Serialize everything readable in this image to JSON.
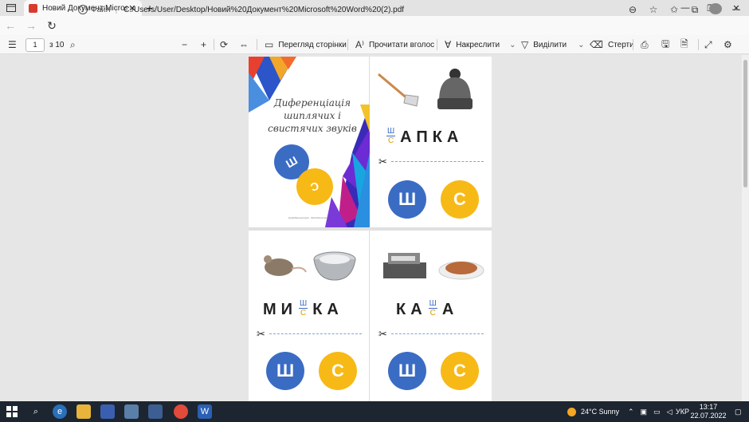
{
  "browser": {
    "tab_title": "Новий Документ Microsoft Wor",
    "tab_close": "✕",
    "new_tab": "+",
    "address_label": "Файл",
    "url": "C:/Users/User/Desktop/Новий%20Документ%20Microsoft%20Word%20(2).pdf"
  },
  "pdf_toolbar": {
    "page_number": "1",
    "page_count": "з 10",
    "page_view_label": "Перегляд сторінки",
    "read_aloud_label": "Прочитати вголос",
    "draw_label": "Накреслити",
    "highlight_label": "Виділити",
    "erase_label": "Стерти"
  },
  "document": {
    "cover": {
      "title": "Диференціація шиплячих і свистячих звуків",
      "circle_top": "Ш",
      "circle_bottom": "С",
      "credit": "розробка вчителя · Word Document"
    },
    "cards": [
      {
        "id": "shapka",
        "prefix": "",
        "suffix": "АПКА",
        "option_top": "Ш",
        "option_bottom": "С",
        "answer_a": "Ш",
        "answer_b": "С",
        "images": [
          "hoe",
          "knit-hat"
        ]
      },
      {
        "id": "myshka",
        "prefix": "МИ",
        "suffix": "КА",
        "option_top": "Ш",
        "option_bottom": "С",
        "answer_a": "Ш",
        "answer_b": "С",
        "images": [
          "mouse",
          "steel-bowl"
        ]
      },
      {
        "id": "kasha",
        "prefix": "КА",
        "suffix": "А",
        "option_top": "Ш",
        "option_bottom": "С",
        "answer_a": "Ш",
        "answer_b": "С",
        "images": [
          "cash-register",
          "buckwheat-plate"
        ]
      }
    ],
    "scissors_symbol": "✂"
  },
  "taskbar": {
    "weather": "24°C  Sunny",
    "language": "УКР",
    "time": "13:17",
    "date": "22.07.2022"
  },
  "colors": {
    "accent_blue": "#3b6cc4",
    "accent_yellow": "#f7b916",
    "pdf_red": "#d83b2e"
  }
}
